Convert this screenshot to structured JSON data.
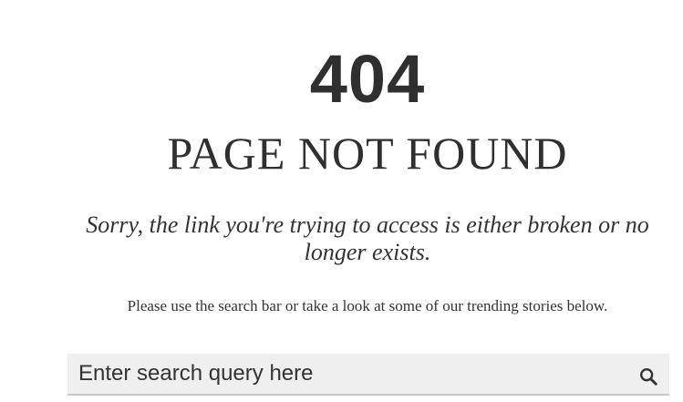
{
  "error": {
    "code": "404",
    "title": "PAGE NOT FOUND",
    "message": "Sorry, the link you're trying to access is either broken or no longer exists.",
    "hint": "Please use the search bar or take a look at some of our trending stories below."
  },
  "search": {
    "placeholder": "Enter search query here",
    "value": "",
    "icon": "search-icon"
  },
  "colors": {
    "text": "#333333",
    "search_background": "#efefef",
    "search_border": "#c7c7c7"
  }
}
